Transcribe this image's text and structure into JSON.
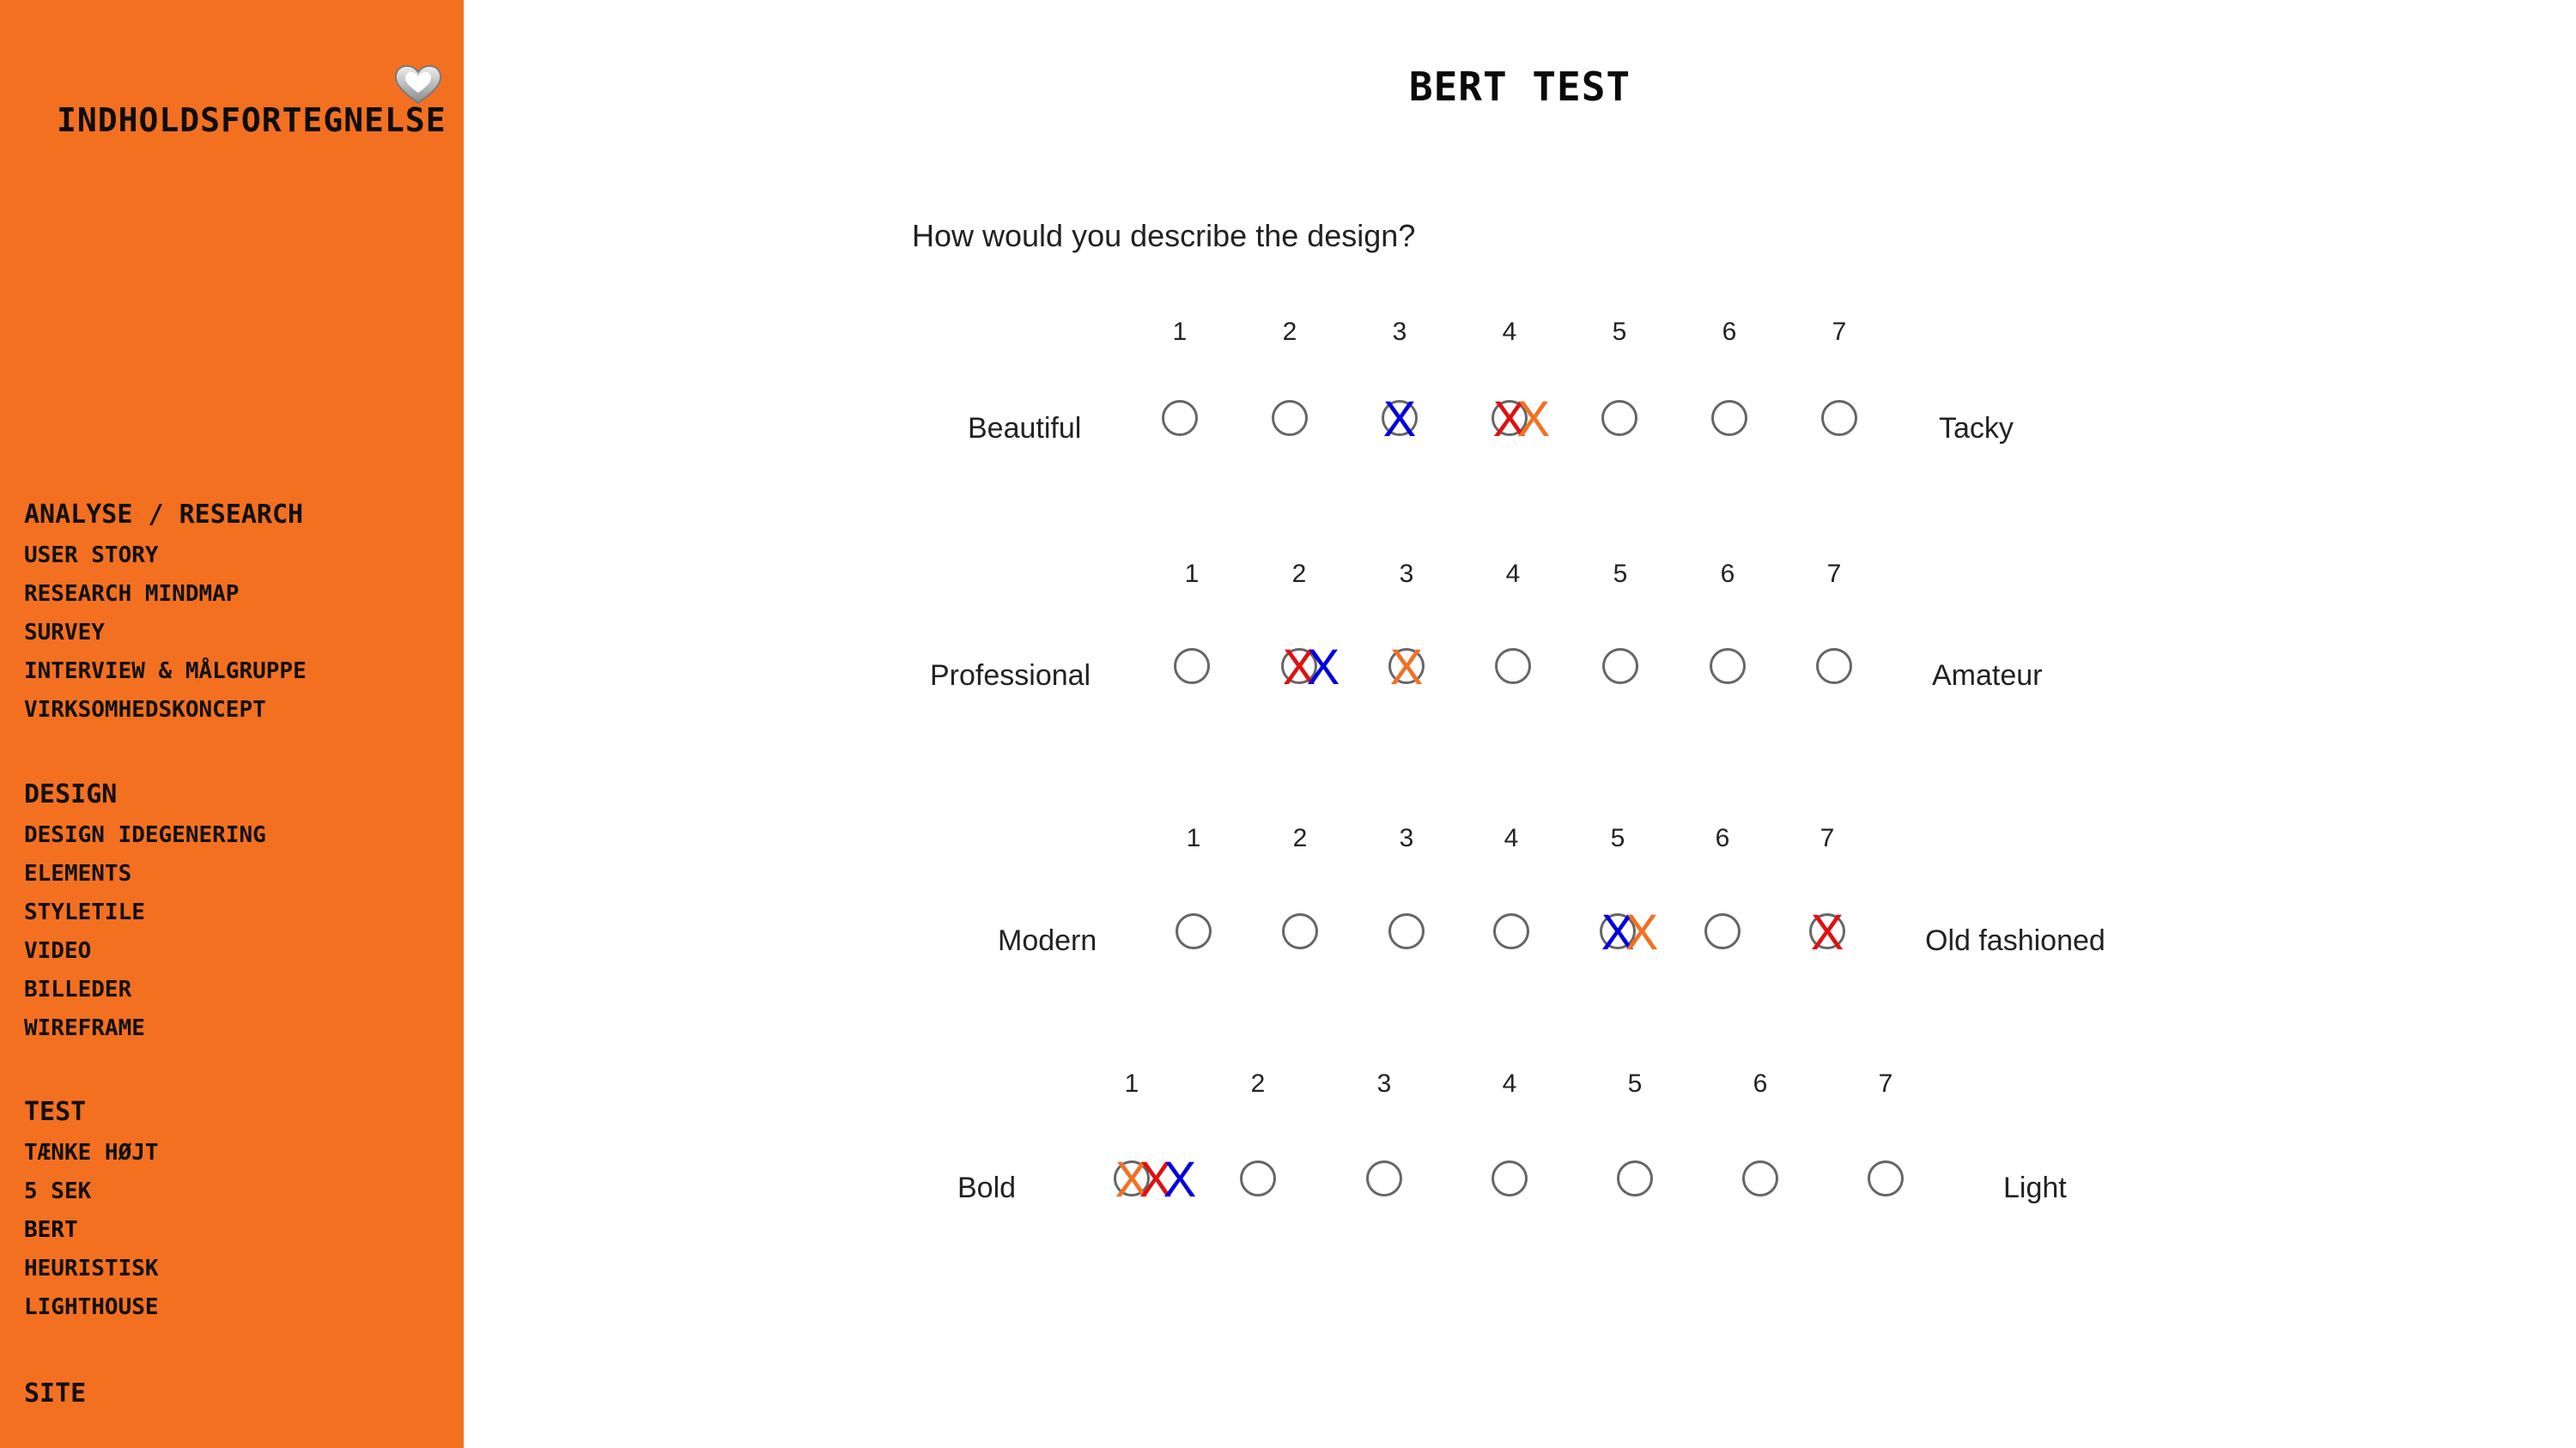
{
  "sidebar": {
    "title": "INDHOLDSFORTEGNELSE",
    "logo_icon": "heart-icon",
    "background": "#f37021",
    "sections": [
      {
        "label": "ANALYSE / RESEARCH",
        "items": [
          "USER STORY",
          "RESEARCH MINDMAP",
          "SURVEY",
          "INTERVIEW & MÅLGRUPPE",
          "VIRKSOMHEDSKONCEPT"
        ]
      },
      {
        "label": "DESIGN",
        "items": [
          "DESIGN IDEGENERING",
          "ELEMENTS",
          "STYLETILE",
          "VIDEO",
          "BILLEDER",
          "WIREFRAME"
        ]
      },
      {
        "label": "TEST",
        "items": [
          "TÆNKE HØJT",
          "5 SEK",
          "BERT",
          "HEURISTISK",
          "LIGHTHOUSE"
        ]
      },
      {
        "label": "SITE",
        "items": []
      }
    ],
    "active_item": "BERT"
  },
  "main": {
    "title": "BERT TEST",
    "question": "How would you describe the design?",
    "scale": [
      "1",
      "2",
      "3",
      "4",
      "5",
      "6",
      "7"
    ],
    "rows": [
      {
        "left": "Beautiful",
        "right": "Tacky",
        "marks": [
          {
            "position": 3,
            "color": "#0000e0"
          },
          {
            "position": 4,
            "color": "#e01010"
          },
          {
            "position": 4,
            "color": "#f37021"
          }
        ]
      },
      {
        "left": "Professional",
        "right": "Amateur",
        "marks": [
          {
            "position": 2,
            "color": "#e01010"
          },
          {
            "position": 2,
            "color": "#0000e0"
          },
          {
            "position": 3,
            "color": "#f37021"
          }
        ]
      },
      {
        "left": "Modern",
        "right": "Old fashioned",
        "marks": [
          {
            "position": 5,
            "color": "#0000e0"
          },
          {
            "position": 5,
            "color": "#f37021"
          },
          {
            "position": 7,
            "color": "#e01010"
          }
        ]
      },
      {
        "left": "Bold",
        "right": "Light",
        "marks": [
          {
            "position": 1,
            "color": "#f37021"
          },
          {
            "position": 1,
            "color": "#e01010"
          },
          {
            "position": 1,
            "color": "#0000e0"
          }
        ]
      }
    ],
    "mark_symbol": "X",
    "colors": {
      "blue": "#0000e0",
      "red": "#e01010",
      "orange": "#f37021"
    }
  }
}
